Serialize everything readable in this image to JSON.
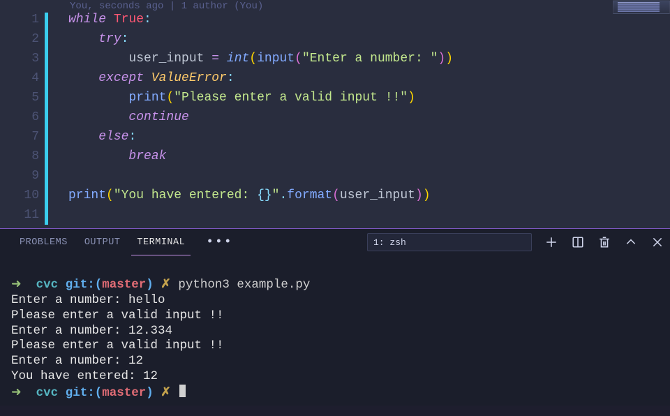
{
  "gitlens": "You, seconds ago | 1 author (You)",
  "lines": {
    "n1": "1",
    "n2": "2",
    "n3": "3",
    "n4": "4",
    "n5": "5",
    "n6": "6",
    "n7": "7",
    "n8": "8",
    "n9": "9",
    "n10": "10",
    "n11": "11"
  },
  "code": {
    "l1": {
      "while": "while",
      "sp": " ",
      "true": "True",
      "colon": ":"
    },
    "l2": {
      "indent": "    ",
      "try": "try",
      "colon": ":"
    },
    "l3": {
      "indent": "        ",
      "var": "user_input",
      "sp1": " ",
      "eq": "=",
      "sp2": " ",
      "int": "int",
      "po": "(",
      "input": "input",
      "pi": "(",
      "str": "\"Enter a number: \"",
      "pc": ")",
      "pc2": ")"
    },
    "l4": {
      "indent": "    ",
      "except": "except",
      "sp": " ",
      "cls": "ValueError",
      "colon": ":"
    },
    "l5": {
      "indent": "        ",
      "print": "print",
      "po": "(",
      "str": "\"Please enter a valid input !!\"",
      "pc": ")"
    },
    "l6": {
      "indent": "        ",
      "continue": "continue"
    },
    "l7": {
      "indent": "    ",
      "else": "else",
      "colon": ":"
    },
    "l8": {
      "indent": "        ",
      "break": "break"
    },
    "l10": {
      "print": "print",
      "po": "(",
      "str": "\"You have entered: ",
      "brl": "{}",
      "strc": "\"",
      "dot": ".",
      "format": "format",
      "pi": "(",
      "var": "user_input",
      "pc": ")",
      "pc2": ")"
    }
  },
  "panel": {
    "tabs": {
      "problems": "PROBLEMS",
      "output": "OUTPUT",
      "terminal": "TERMINAL"
    },
    "dropdown": "1: zsh"
  },
  "terminal": {
    "arrow": "➜ ",
    "dir": " cvc",
    "git": " git:(",
    "branch": "master",
    "gitc": ")",
    "x": " ✗ ",
    "cmd1": "python3 example.py",
    "out1": "Enter a number: hello",
    "out2": "Please enter a valid input !!",
    "out3": "Enter a number: 12.334",
    "out4": "Please enter a valid input !!",
    "out5": "Enter a number: 12",
    "out6": "You have entered: 12"
  }
}
